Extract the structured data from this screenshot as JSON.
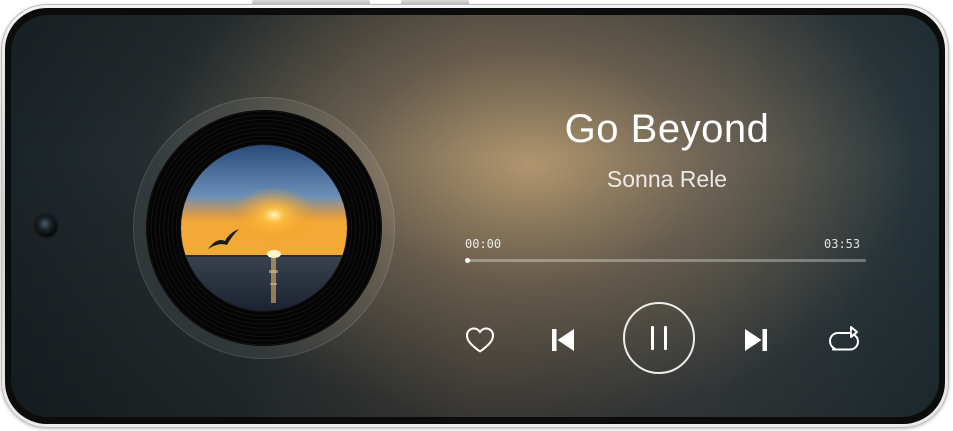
{
  "track": {
    "title": "Go Beyond",
    "artist": "Sonna Rele",
    "current_time": "00:00",
    "total_time": "03:53",
    "progress_fraction": 0.0
  },
  "controls": {
    "favorite": "heart-icon",
    "previous": "skip-previous-icon",
    "play_pause": "pause-icon",
    "next": "skip-next-icon",
    "repeat": "repeat-icon"
  },
  "colors": {
    "text_primary": "#ffffff",
    "progress_track": "rgba(255,255,255,0.32)"
  }
}
